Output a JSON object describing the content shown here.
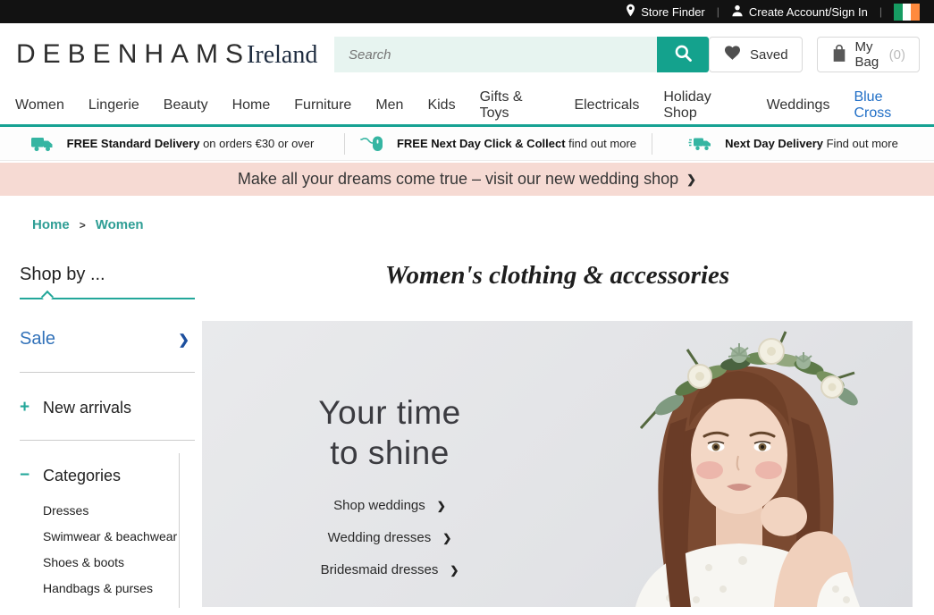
{
  "topbar": {
    "store_finder": "Store Finder",
    "account": "Create Account/Sign In",
    "separator": "|",
    "flag": {
      "name": "ireland-flag",
      "green": "#169b62",
      "white": "#ffffff",
      "orange": "#ff8a3d"
    }
  },
  "header": {
    "logo_main": "DEBENHAMS",
    "logo_suffix": "Ireland",
    "search_placeholder": "Search",
    "saved_label": "Saved",
    "bag_label": "My Bag",
    "bag_count": "(0)"
  },
  "nav": {
    "items": [
      {
        "label": "Women"
      },
      {
        "label": "Lingerie"
      },
      {
        "label": "Beauty"
      },
      {
        "label": "Home"
      },
      {
        "label": "Furniture"
      },
      {
        "label": "Men"
      },
      {
        "label": "Kids"
      },
      {
        "label": "Gifts & Toys"
      },
      {
        "label": "Electricals"
      },
      {
        "label": "Holiday Shop"
      },
      {
        "label": "Weddings"
      },
      {
        "label": "Blue Cross",
        "highlight": true
      }
    ]
  },
  "delivery": {
    "items": [
      {
        "icon": "delivery-truck-icon",
        "bold": "FREE Standard Delivery",
        "rest": "on orders €30 or over"
      },
      {
        "icon": "computer-mouse-icon",
        "bold": "FREE Next Day Click & Collect",
        "rest": "find out more"
      },
      {
        "icon": "express-truck-icon",
        "bold": "Next Day Delivery",
        "rest": "Find out more"
      }
    ]
  },
  "promo_banner": {
    "text": "Make all your dreams come true – visit our new wedding shop",
    "chevron": "❯"
  },
  "breadcrumb": {
    "home": "Home",
    "separator": ">",
    "current": "Women"
  },
  "sidebar": {
    "title": "Shop by ...",
    "sale_label": "Sale",
    "sale_chevron": "❯",
    "sections": [
      {
        "symbol": "+",
        "label": "New arrivals"
      },
      {
        "symbol": "−",
        "label": "Categories"
      }
    ],
    "categories": [
      "Dresses",
      "Swimwear & beachwear",
      "Shoes & boots",
      "Handbags & purses"
    ]
  },
  "main": {
    "heading": "Women's clothing & accessories",
    "hero": {
      "title_line1": "Your time",
      "title_line2": "to shine",
      "links": [
        "Shop weddings",
        "Wedding dresses",
        "Bridesmaid dresses"
      ],
      "link_chevron": "❯"
    }
  },
  "colors": {
    "accent_teal": "#16a293",
    "icon_teal": "#35b5a2",
    "promo_pink": "#f6dad3",
    "sale_blue": "#3272b9",
    "chevron_navy": "#1c4f9e",
    "nav_highlight_blue": "#1f6ec6",
    "breadcrumb_teal": "#2f9e95",
    "topbar_black": "#121212"
  }
}
